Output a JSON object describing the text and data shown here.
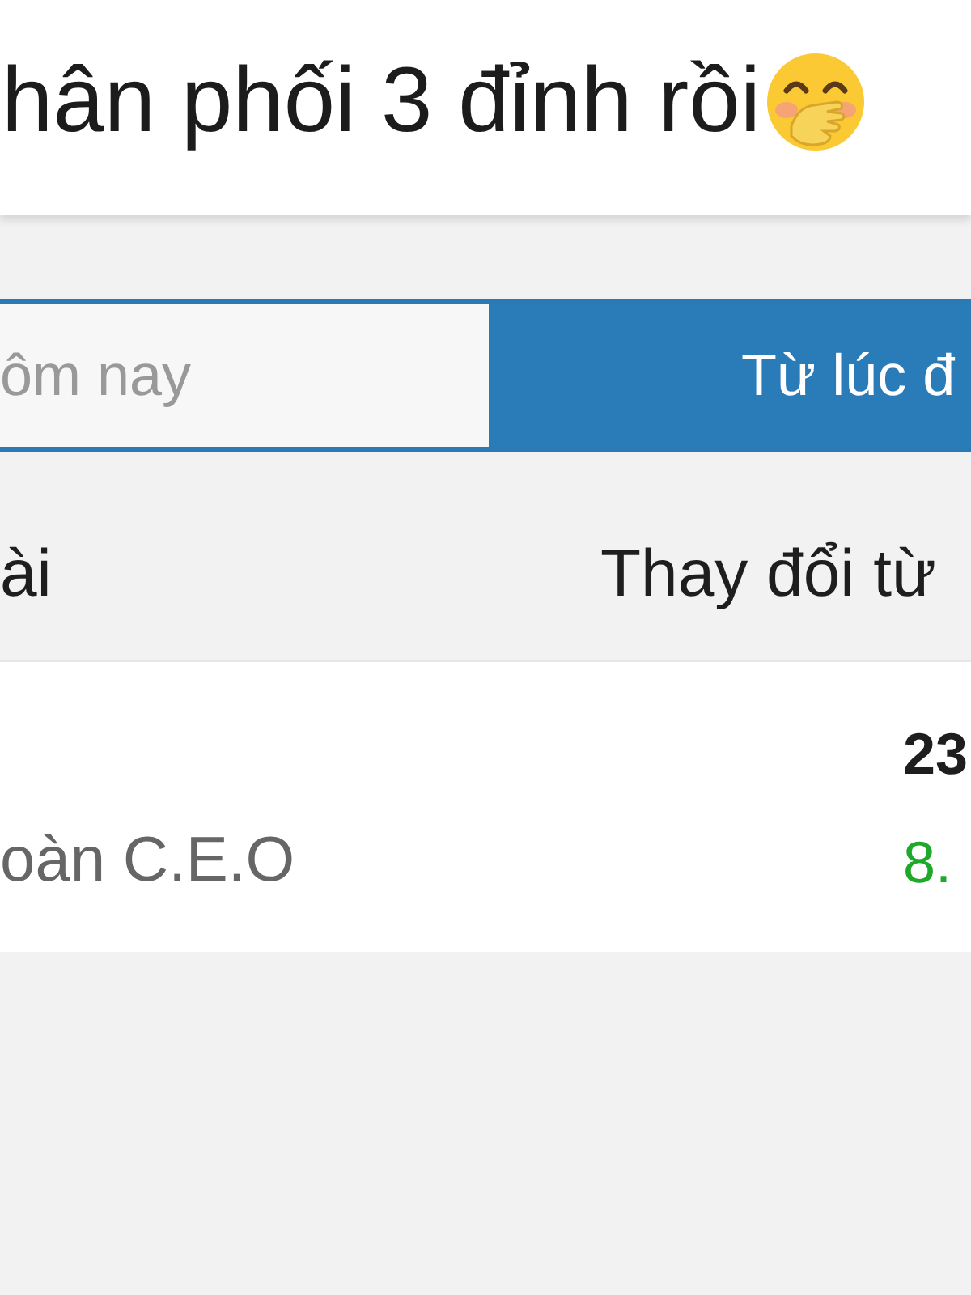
{
  "header": {
    "title": "hân phối 3 đỉnh rồi"
  },
  "tabs": [
    {
      "label": "ôm nay",
      "selected": false
    },
    {
      "label": "Từ lúc đ",
      "selected": true
    }
  ],
  "table": {
    "columns": [
      "ài",
      "Thay đổi từ"
    ],
    "rows": [
      {
        "column_1": "oàn C.E.O",
        "column_2": "23",
        "column_3": "8.",
        "positive": true
      }
    ]
  }
}
